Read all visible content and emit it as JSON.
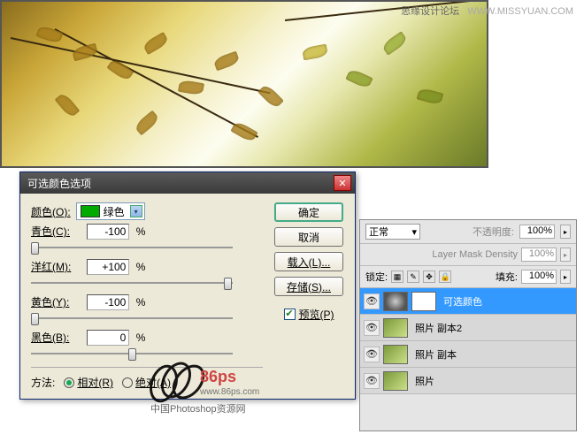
{
  "watermark_top": {
    "cn": "思缘设计论坛",
    "en": "WWW.MISSYUAN.COM"
  },
  "dialog": {
    "title": "可选颜色选项",
    "color_label": "颜色(O):",
    "color_name": "绿色",
    "sliders": {
      "cyan": {
        "label": "青色(C):",
        "value": "-100",
        "pct": "%"
      },
      "magenta": {
        "label": "洋红(M):",
        "value": "+100",
        "pct": "%"
      },
      "yellow": {
        "label": "黄色(Y):",
        "value": "-100",
        "pct": "%"
      },
      "black": {
        "label": "黑色(B):",
        "value": "0",
        "pct": "%"
      }
    },
    "method_label": "方法:",
    "method_relative": "相对(R)",
    "method_absolute": "绝对(A)",
    "buttons": {
      "ok": "确定",
      "cancel": "取消",
      "load": "载入(L)...",
      "save": "存储(S)..."
    },
    "preview": "预览(P)"
  },
  "layers": {
    "blend_mode": "正常",
    "opacity_label": "不透明度:",
    "opacity_value": "100%",
    "density_label": "Layer Mask Density",
    "density_value": "100%",
    "lock_label": "锁定:",
    "fill_label": "填充:",
    "fill_value": "100%",
    "items": [
      {
        "name": "可选颜色",
        "type": "adj",
        "selected": true
      },
      {
        "name": "照片 副本2",
        "type": "photo"
      },
      {
        "name": "照片 副本",
        "type": "photo"
      },
      {
        "name": "照片",
        "type": "photo"
      }
    ]
  },
  "wm86": {
    "brand": "86ps",
    "url": "www.86ps.com",
    "cn": "中国Photoshop资源网"
  }
}
